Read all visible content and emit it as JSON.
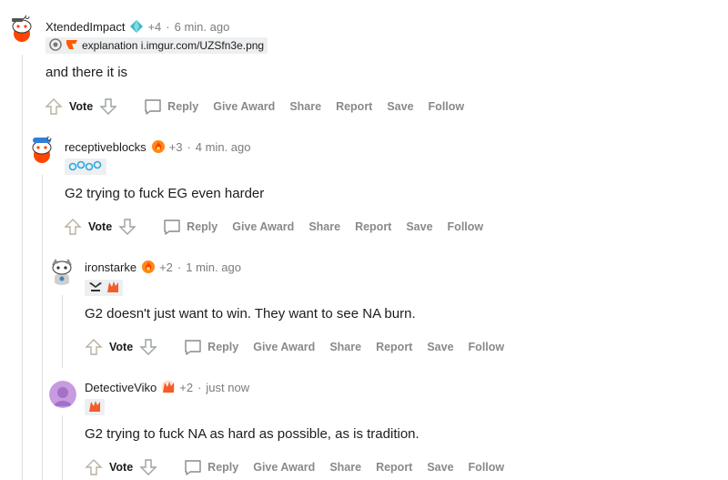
{
  "colors": {
    "thread_line": "#e0e0e0",
    "meta_gray": "#7c7c7c",
    "action_gray": "#878a8c",
    "text": "#1c1c1c",
    "flair_bg": "#edeff1"
  },
  "comments": [
    {
      "username": "XtendedImpact",
      "award_icon": "diamond-award-icon",
      "points": "+4",
      "time": "6 min. ago",
      "flair_text": "explanation i.imgur.com/UZSfn3e.png",
      "flair_icons": [
        "lol-emblem-icon",
        "fnatic-logo-icon"
      ],
      "body": "and there it is",
      "vote_label": "Vote",
      "actions": [
        "Reply",
        "Give Award",
        "Share",
        "Report",
        "Save",
        "Follow"
      ]
    },
    {
      "username": "receptiveblocks",
      "award_icon": "fire-award-icon",
      "points": "+3",
      "time": "4 min. ago",
      "flair_text": "",
      "flair_icons": [
        "cloud9-logo-icon"
      ],
      "body": "G2 trying to fuck EG even harder",
      "vote_label": "Vote",
      "actions": [
        "Reply",
        "Give Award",
        "Share",
        "Report",
        "Save",
        "Follow"
      ]
    },
    {
      "username": "ironstarke",
      "award_icon": "fire-award-icon",
      "points": "+2",
      "time": "1 min. ago",
      "flair_text": "",
      "flair_icons": [
        "lcs-logo-icon",
        "g2-logo-icon"
      ],
      "body": "G2 doesn't just want to win. They want to see NA burn.",
      "vote_label": "Vote",
      "actions": [
        "Reply",
        "Give Award",
        "Share",
        "Report",
        "Save",
        "Follow"
      ]
    },
    {
      "username": "DetectiveViko",
      "award_icon": "g2-award-icon",
      "points": "+2",
      "time": "just now",
      "flair_text": "",
      "flair_icons": [
        "g2-logo-icon"
      ],
      "body": "G2 trying to fuck NA as hard as possible, as is tradition.",
      "vote_label": "Vote",
      "actions": [
        "Reply",
        "Give Award",
        "Share",
        "Report",
        "Save",
        "Follow"
      ]
    }
  ]
}
